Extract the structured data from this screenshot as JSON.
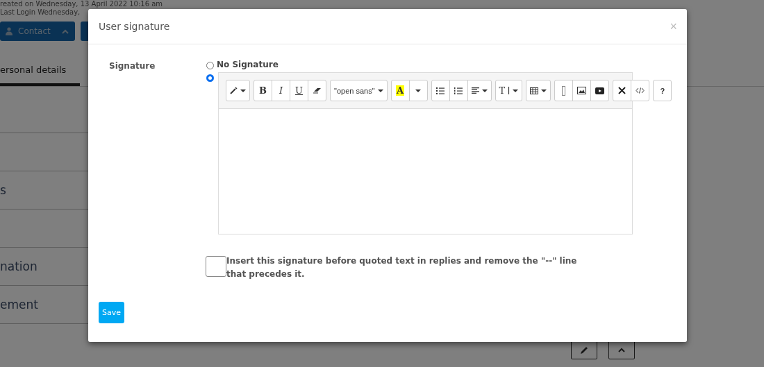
{
  "page": {
    "created": "reated on Wednesday, 13 April 2022 10:16 am",
    "last_login": "Last Login Wednesday,",
    "contact_button": "Contact",
    "tab": "ersonal details",
    "sections": [
      {
        "label": "s"
      },
      {
        "label": "nation"
      },
      {
        "label": "ement"
      }
    ]
  },
  "modal": {
    "title": "User signature",
    "close": "×",
    "field_label": "Signature",
    "options": [
      {
        "label": "No Signature",
        "selected": false
      },
      {
        "selected": true
      }
    ],
    "toolbar": [
      [
        {
          "kind": "magic",
          "caret": true
        }
      ],
      [
        {
          "kind": "bold",
          "label": "B"
        },
        {
          "kind": "italic",
          "label": "I"
        },
        {
          "kind": "underline",
          "label": "U"
        },
        {
          "kind": "eraser"
        }
      ],
      [
        {
          "kind": "font",
          "label": "\"open sans\"",
          "caret": true
        }
      ],
      [
        {
          "kind": "color",
          "label": "A"
        },
        {
          "kind": "caret"
        }
      ],
      [
        {
          "kind": "ul"
        },
        {
          "kind": "ol"
        },
        {
          "kind": "align",
          "caret": true
        }
      ],
      [
        {
          "kind": "height",
          "label": "T",
          "caret": true
        }
      ],
      [
        {
          "kind": "table",
          "caret": true
        }
      ],
      [
        {
          "kind": "blank"
        },
        {
          "kind": "image"
        },
        {
          "kind": "video"
        }
      ],
      [
        {
          "kind": "fullscreen"
        },
        {
          "kind": "code"
        }
      ],
      [
        {
          "kind": "help",
          "label": "?"
        }
      ]
    ],
    "quote_option": {
      "label": "Insert this signature before quoted text in replies and remove the \"--\" line that precedes it.",
      "checked": false
    },
    "save": "Save"
  }
}
